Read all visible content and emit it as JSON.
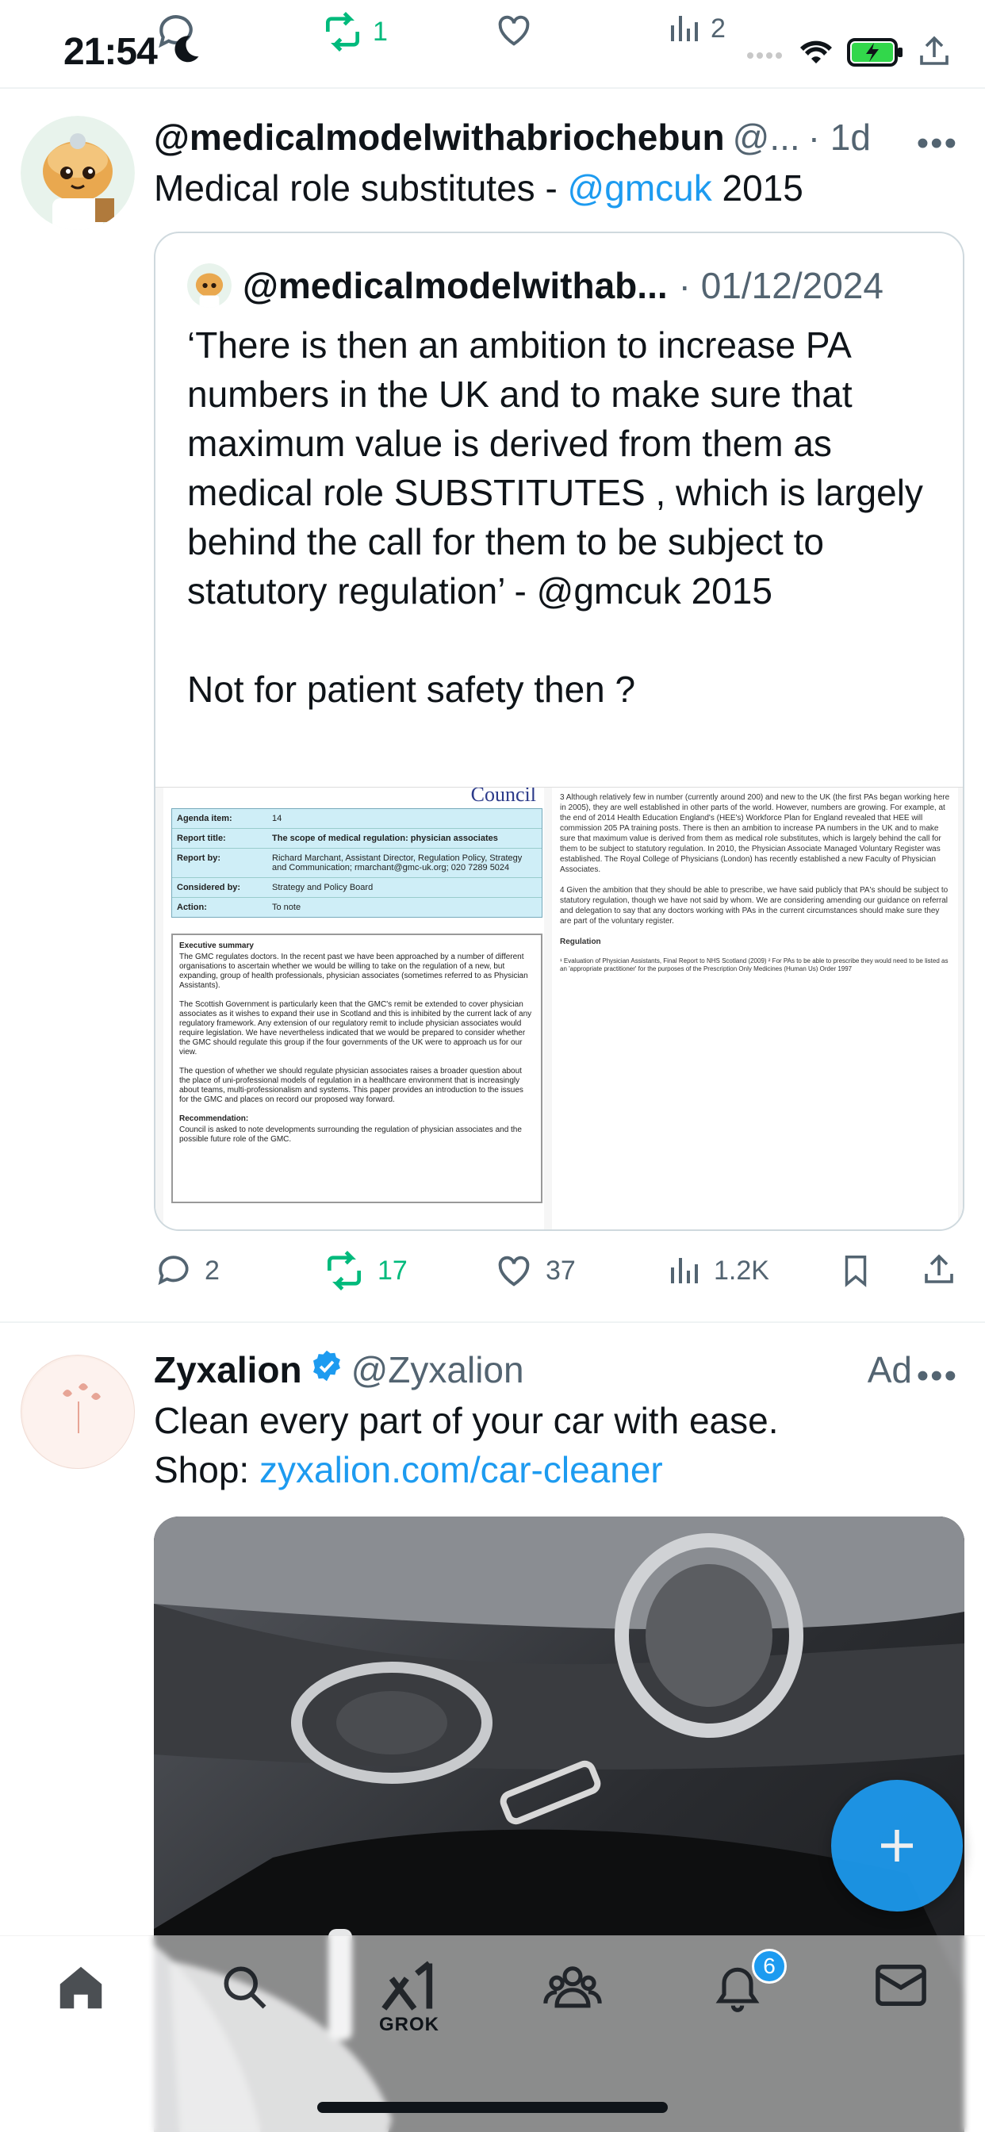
{
  "status_bar": {
    "time": "21:54"
  },
  "ghost_actions": {
    "retweets": "1",
    "views": "2"
  },
  "tweet1": {
    "name": "@medicalmodelwithabriochebun",
    "handle": "@...",
    "time": "· 1d",
    "text_prefix": "Medical role substitutes - ",
    "mention": "@gmcuk",
    "text_suffix": " 2015",
    "quote": {
      "name": "@medicalmodelwithab...",
      "date": "· 01/12/2024",
      "text": "‘There is then an ambition to increase PA numbers in the UK and to make sure that maximum value is derived from them as medical role SUBSTITUTES , which is largely behind the call for them to be subject to statutory regulation’ - @gmcuk 2015\n\nNot for patient safety then ?"
    },
    "document": {
      "council": "Council",
      "rows": [
        {
          "k": "Agenda item:",
          "v": "14"
        },
        {
          "k": "Report title:",
          "v": "The scope of medical regulation: physician associates"
        },
        {
          "k": "Report by:",
          "v": "Richard Marchant, Assistant Director, Regulation Policy, Strategy and Communication; rmarchant@gmc-uk.org; 020 7289 5024"
        },
        {
          "k": "Considered by:",
          "v": "Strategy and Policy Board"
        },
        {
          "k": "Action:",
          "v": "To note"
        }
      ],
      "exec_title": "Executive summary",
      "exec_p1": "The GMC regulates doctors. In the recent past we have been approached by a number of different organisations to ascertain whether we would be willing to take on the regulation of a new, but expanding, group of health professionals, physician associates (sometimes referred to as Physician Assistants).",
      "exec_p2": "The Scottish Government is particularly keen that the GMC's remit be extended to cover physician associates as it wishes to expand their use in Scotland and this is inhibited by the current lack of any regulatory framework. Any extension of our regulatory remit to include physician associates would require legislation. We have nevertheless indicated that we would be prepared to consider whether the GMC should regulate this group if the four governments of the UK were to approach us for our view.",
      "exec_p3": "The question of whether we should regulate physician associates raises a broader question about the place of uni-professional models of regulation in a healthcare environment that is increasingly about teams, multi-professionalism and systems. This paper provides an introduction to the issues for the GMC and places on record our proposed way forward.",
      "rec_title": "Recommendation:",
      "rec_text": "Council is asked to note developments surrounding the regulation of physician associates and the possible future role of the GMC.",
      "right_p3": "3   Although relatively few in number (currently around 200) and new to the UK (the first PAs began working here in 2005), they are well established in other parts of the world. However, numbers are growing. For example, at the end of 2014 Health Education England's (HEE's) Workforce Plan for England revealed that HEE will commission 205 PA training posts. There is then an ambition to increase PA numbers in the UK and to make sure that maximum value is derived from them as medical role substitutes, which is largely behind the call for them to be subject to statutory regulation. In 2010, the Physician Associate Managed Voluntary Register was established. The Royal College of Physicians (London) has recently established a new Faculty of Physician Associates.",
      "right_p4": "4   Given the ambition that they should be able to prescribe, we have said publicly that PA's should be subject to statutory regulation, though we have not said by whom. We are considering amending our guidance on referral and delegation to say that any doctors working with PAs in the current circumstances should make sure they are part of the voluntary register.",
      "right_reg": "Regulation",
      "right_foot": "¹ Evaluation of Physician Assistants, Final Report to NHS Scotland (2009)  ² For PAs to be able to prescribe they would need to be listed as an 'appropriate practitioner' for the purposes of the Prescription Only Medicines (Human Us) Order 1997"
    },
    "actions": {
      "replies": "2",
      "retweets": "17",
      "likes": "37",
      "views": "1.2K"
    }
  },
  "ad_tweet": {
    "name": "Zyxalion",
    "handle": "@Zyxalion",
    "ad_label": "Ad",
    "line1": "Clean every part of your car with ease.",
    "line2_prefix": "Shop: ",
    "link": "zyxalion.com/car-cleaner"
  },
  "tabbar": {
    "grok_label": "GROK",
    "notifications_badge": "6"
  },
  "colors": {
    "accent": "#1d9bf0",
    "retweet_green": "#00ba7c",
    "muted": "#536471",
    "text": "#0f1419"
  }
}
